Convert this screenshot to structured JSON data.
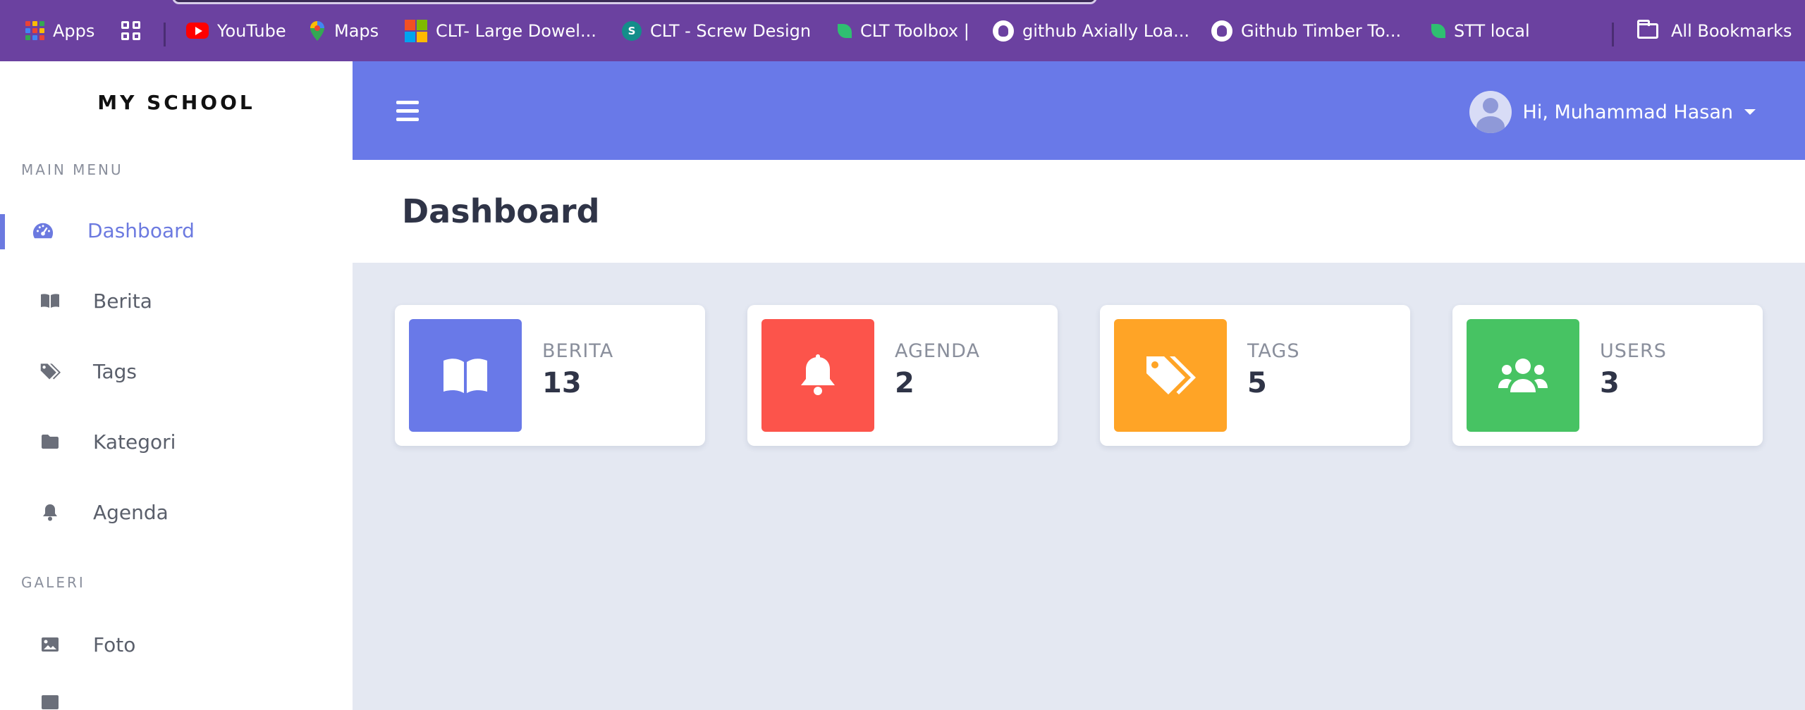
{
  "bookmarks": {
    "items": [
      {
        "label": "Apps",
        "icon": "apps-grid-icon"
      },
      {
        "label": "",
        "icon": "tab-groups-icon"
      },
      {
        "label": "YouTube",
        "icon": "youtube-icon"
      },
      {
        "label": "Maps",
        "icon": "maps-pin-icon"
      },
      {
        "label": "CLT- Large Dowel...",
        "icon": "microsoft-icon"
      },
      {
        "label": "CLT - Screw Design",
        "icon": "sharepoint-icon"
      },
      {
        "label": "CLT Toolbox |",
        "icon": "leaf-icon"
      },
      {
        "label": "github Axially Loa...",
        "icon": "github-icon"
      },
      {
        "label": "Github Timber To...",
        "icon": "github-icon"
      },
      {
        "label": "STT local",
        "icon": "leaf-icon"
      },
      {
        "label": "All Bookmarks",
        "icon": "folder-icon"
      }
    ]
  },
  "sidebar": {
    "brand": "MY SCHOOL",
    "main_menu_label": "MAIN MENU",
    "galeri_label": "GALERI",
    "items": [
      {
        "label": "Dashboard",
        "icon": "dashboard-gauge-icon",
        "active": true
      },
      {
        "label": "Berita",
        "icon": "book-open-icon"
      },
      {
        "label": "Tags",
        "icon": "tags-icon"
      },
      {
        "label": "Kategori",
        "icon": "folder-icon"
      },
      {
        "label": "Agenda",
        "icon": "bell-icon"
      }
    ],
    "galeri_items": [
      {
        "label": "Foto",
        "icon": "image-icon"
      }
    ]
  },
  "header": {
    "user_greeting": "Hi, Muhammad Hasan"
  },
  "page": {
    "title": "Dashboard"
  },
  "stats": [
    {
      "label": "BERITA",
      "value": "13",
      "color": "#6979e8",
      "icon": "book-open-icon"
    },
    {
      "label": "AGENDA",
      "value": "2",
      "color": "#fc544b",
      "icon": "bell-icon"
    },
    {
      "label": "TAGS",
      "value": "5",
      "color": "#ffa426",
      "icon": "tags-icon"
    },
    {
      "label": "USERS",
      "value": "3",
      "color": "#47c363",
      "icon": "users-icon"
    }
  ],
  "colors": {
    "bookmark_bar": "#6b41a0",
    "primary": "#6979e8",
    "background": "#e4e8f2"
  }
}
